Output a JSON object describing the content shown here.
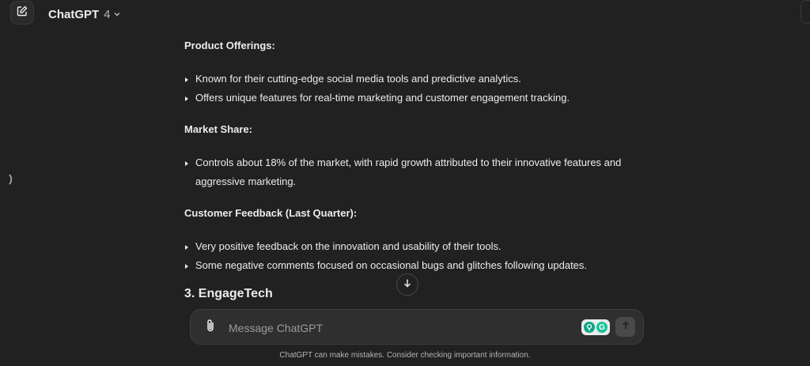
{
  "header": {
    "model_name": "ChatGPT",
    "model_version": "4"
  },
  "content": {
    "sections": [
      {
        "title": "Product Offerings:",
        "bullets": [
          "Known for their cutting-edge social media tools and predictive analytics.",
          "Offers unique features for real-time marketing and customer engagement tracking."
        ]
      },
      {
        "title": "Market Share:",
        "bullets": [
          "Controls about 18% of the market, with rapid growth attributed to their innovative features and aggressive marketing."
        ]
      },
      {
        "title": "Customer Feedback (Last Quarter):",
        "bullets": [
          "Very positive feedback on the innovation and usability of their tools.",
          "Some negative comments focused on occasional bugs and glitches following updates."
        ]
      }
    ],
    "next_heading": "3. EngageTech"
  },
  "composer": {
    "placeholder": "Message ChatGPT",
    "ext_label": "G"
  },
  "footer": {
    "disclaimer": "ChatGPT can make mistakes. Consider checking important information."
  },
  "icons": {
    "new_chat": "pencil-square-icon",
    "model_dropdown": "chevron-down-icon",
    "sidebar": "chevron-right-icon",
    "scroll": "arrow-down-icon",
    "attach": "paperclip-icon",
    "send": "arrow-up-icon"
  }
}
